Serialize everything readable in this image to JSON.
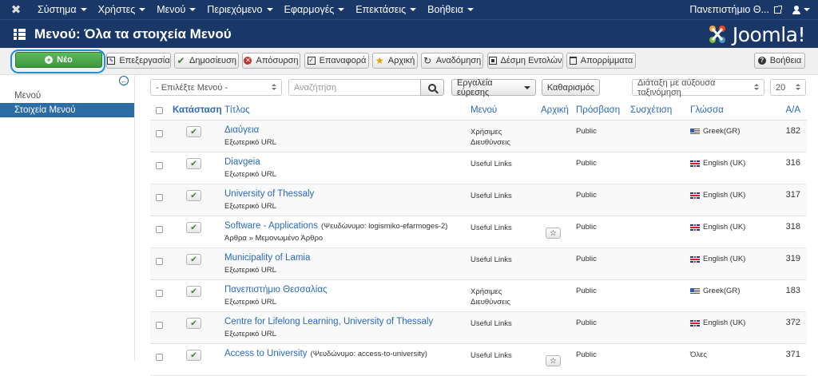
{
  "nav": {
    "menu": [
      "Σύστημα",
      "Χρήστες",
      "Μενού",
      "Περιεχόμενο",
      "Εφαρμογές",
      "Επεκτάσεις",
      "Βοήθεια"
    ],
    "site_name": "Πανεπιστήμιο Θ..."
  },
  "header": {
    "title": "Μενού: Όλα τα στοιχεία Μενού",
    "brand": "Joomla!"
  },
  "toolbar": {
    "new": "Νέο",
    "edit": "Επεξεργασία",
    "publish": "Δημοσίευση",
    "unpublish": "Απόσυρση",
    "checkin": "Επαναφορά",
    "home": "Αρχική",
    "rebuild": "Αναδόμηση",
    "batch": "Δέσμη Εντολών",
    "trash": "Απορρίμματα",
    "help": "Βοήθεια"
  },
  "sidebar": {
    "items": [
      {
        "label": "Μενού",
        "active": false
      },
      {
        "label": "Στοιχεία Μενού",
        "active": true
      }
    ]
  },
  "filters": {
    "menu_select": "- Επιλέξτε Μενού -",
    "search_placeholder": "Αναζήτηση",
    "search_tools": "Εργαλεία εύρεσης",
    "clear": "Καθαρισμός",
    "ordering": "Διάταξη με αύξουσα ταξινόμηση",
    "limit": "20"
  },
  "table": {
    "headers": {
      "status": "Κατάσταση",
      "title": "Τίτλος",
      "menu": "Μενού",
      "home": "Αρχική",
      "access": "Πρόσβαση",
      "association": "Συσχέτιση",
      "language": "Γλώσσα",
      "id": "Α/Α"
    },
    "rows": [
      {
        "title": "Διαύγεια",
        "alias": "",
        "type": "Εξωτερικό URL",
        "menu": "Χρήσιμες Διευθύνσεις",
        "home": false,
        "access": "Public",
        "flag": "gr",
        "language": "Greek(GR)",
        "id": "182"
      },
      {
        "title": "Diavgeia",
        "alias": "",
        "type": "Εξωτερικό URL",
        "menu": "Useful Links",
        "home": false,
        "access": "Public",
        "flag": "uk",
        "language": "English (UK)",
        "id": "316"
      },
      {
        "title": "University of Thessaly",
        "alias": "",
        "type": "Εξωτερικό URL",
        "menu": "Useful Links",
        "home": false,
        "access": "Public",
        "flag": "uk",
        "language": "English (UK)",
        "id": "317"
      },
      {
        "title": "Software - Applications",
        "alias": "(Ψευδώνυμο: logismiko-efarmoges-2)",
        "type": "Άρθρα » Μεμονωμένο Άρθρο",
        "menu": "Useful Links",
        "home": true,
        "access": "Public",
        "flag": "uk",
        "language": "English (UK)",
        "id": "318"
      },
      {
        "title": "Municipality of Lamia",
        "alias": "",
        "type": "Εξωτερικό URL",
        "menu": "Useful Links",
        "home": false,
        "access": "Public",
        "flag": "uk",
        "language": "English (UK)",
        "id": "319"
      },
      {
        "title": "Πανεπιστήμιο Θεσσαλίας",
        "alias": "",
        "type": "Εξωτερικό URL",
        "menu": "Χρήσιμες Διευθύνσεις",
        "home": false,
        "access": "Public",
        "flag": "gr",
        "language": "Greek(GR)",
        "id": "183"
      },
      {
        "title": "Centre for Lifelong Learning, University of Thessaly",
        "alias": "",
        "type": "Εξωτερικό URL",
        "menu": "Useful Links",
        "home": false,
        "access": "Public",
        "flag": "uk",
        "language": "English (UK)",
        "id": "372"
      },
      {
        "title": "Access to University",
        "alias": "(Ψευδώνυμο: access-to-university)",
        "type": "",
        "menu": "Useful Links",
        "home": true,
        "access": "Public",
        "flag": "",
        "language": "Όλες",
        "id": "371"
      }
    ]
  }
}
